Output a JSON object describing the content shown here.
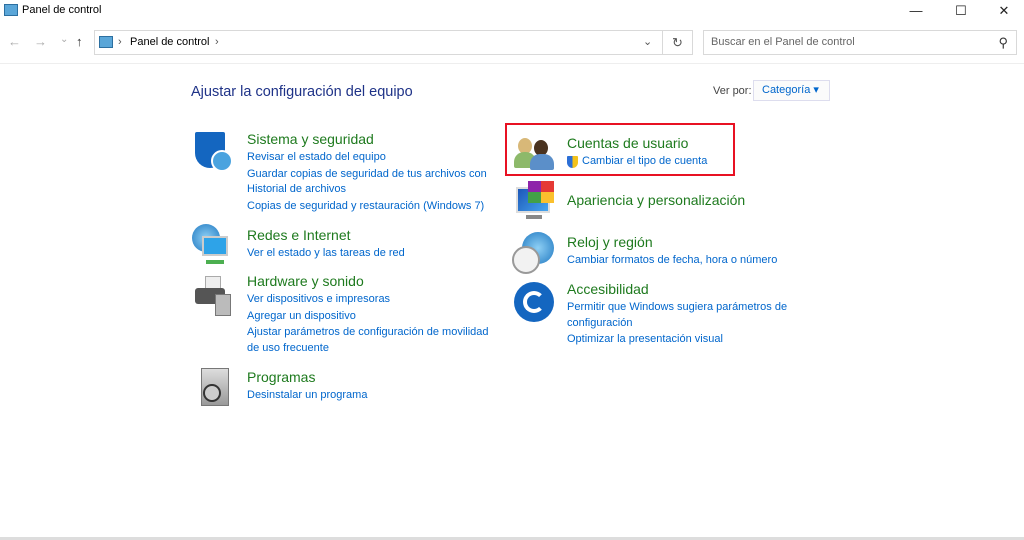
{
  "window": {
    "title": "Panel de control",
    "minimize": "—",
    "maximize": "☐",
    "close": "✕"
  },
  "toolbar": {
    "back": "←",
    "forward": "→",
    "recent": "⌄",
    "up": "↑",
    "breadcrumb": "Panel de control",
    "sep": "›",
    "dropdown": "⌄",
    "refresh": "↻",
    "search_placeholder": "Buscar en el Panel de control",
    "search_icon": "⚲"
  },
  "main": {
    "title": "Ajustar la configuración del equipo",
    "view_by_label": "Ver por:",
    "view_by_value": "Categoría ▾"
  },
  "categories": [
    {
      "title": "Sistema y seguridad",
      "links": [
        "Revisar el estado del equipo",
        "Guardar copias de seguridad de tus archivos con Historial de archivos",
        "Copias de seguridad y restauración (Windows 7)"
      ]
    },
    {
      "title": "Redes e Internet",
      "links": [
        "Ver el estado y las tareas de red"
      ]
    },
    {
      "title": "Hardware y sonido",
      "links": [
        "Ver dispositivos e impresoras",
        "Agregar un dispositivo",
        "Ajustar parámetros de configuración de movilidad de uso frecuente"
      ]
    },
    {
      "title": "Programas",
      "links": [
        "Desinstalar un programa"
      ]
    },
    {
      "title": "Cuentas de usuario",
      "links": [
        "Cambiar el tipo de cuenta"
      ]
    },
    {
      "title": "Apariencia y personalización",
      "links": []
    },
    {
      "title": "Reloj y región",
      "links": [
        "Cambiar formatos de fecha, hora o número"
      ]
    },
    {
      "title": "Accesibilidad",
      "links": [
        "Permitir que Windows sugiera parámetros de configuración",
        "Optimizar la presentación visual"
      ]
    }
  ],
  "colors": {
    "heading": "#1e7a1e",
    "link": "#0066cc",
    "highlight": "#e81123"
  }
}
